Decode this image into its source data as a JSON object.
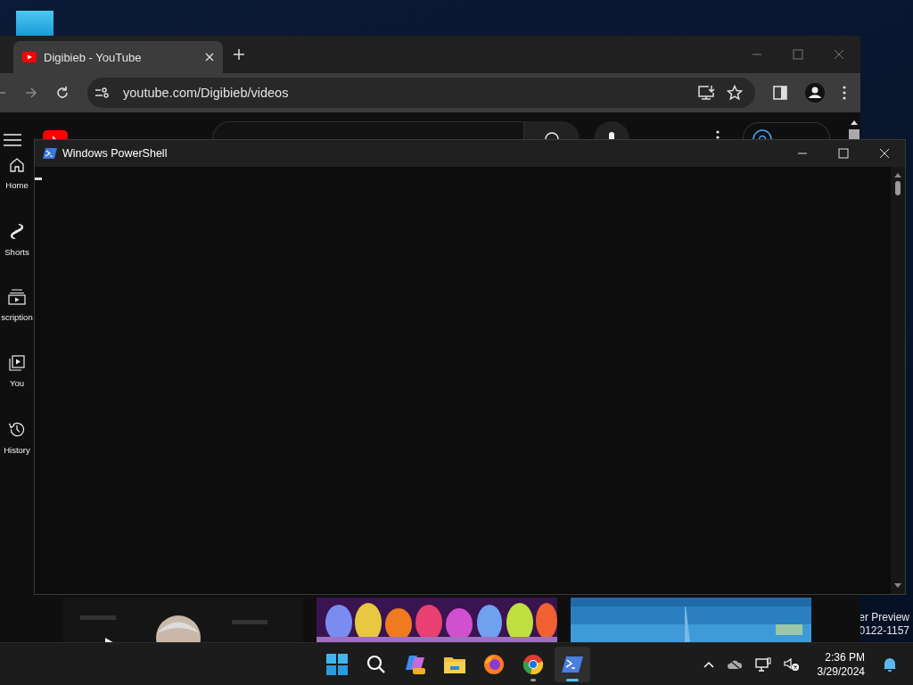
{
  "desktop": {
    "watermark": [
      "er Preview",
      "0122-1157"
    ]
  },
  "browser": {
    "tabs": [
      {
        "title": "Digibieb - YouTube",
        "selected": true
      }
    ],
    "address": "youtube.com/Digibieb/videos",
    "page": {
      "sidebar": [
        {
          "label": "Home",
          "kind": "home"
        },
        {
          "label": "Shorts",
          "kind": "shorts"
        },
        {
          "label": "scription",
          "kind": "subscriptions"
        },
        {
          "label": "You",
          "kind": "you"
        },
        {
          "label": "History",
          "kind": "history"
        }
      ]
    }
  },
  "powershell": {
    "title": "Windows PowerShell"
  },
  "taskbar": {
    "apps": [
      {
        "kind": "start",
        "running": false,
        "selected": false
      },
      {
        "kind": "search",
        "running": false,
        "selected": false
      },
      {
        "kind": "copilot",
        "running": false,
        "selected": false
      },
      {
        "kind": "explorer",
        "running": false,
        "selected": false
      },
      {
        "kind": "firefox",
        "running": false,
        "selected": false
      },
      {
        "kind": "chrome",
        "running": true,
        "selected": false
      },
      {
        "kind": "powershell",
        "running": true,
        "selected": true
      }
    ],
    "time": "2:36 PM",
    "date": "3/29/2024"
  }
}
